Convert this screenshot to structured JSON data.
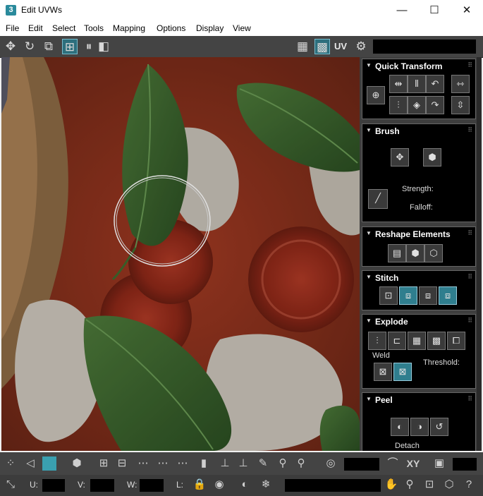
{
  "window": {
    "title": "Edit UVWs",
    "app_icon": "3",
    "minimize": "—",
    "maximize": "☐",
    "close": "✕"
  },
  "menu": [
    "File",
    "Edit",
    "Select",
    "Tools",
    "Mapping",
    "Options",
    "Display",
    "View"
  ],
  "toolbar": {
    "uv_label": "UV"
  },
  "panels": {
    "quick_transform": {
      "title": "Quick Transform"
    },
    "brush": {
      "title": "Brush",
      "strength_label": "Strength:",
      "falloff_label": "Falloff:"
    },
    "reshape": {
      "title": "Reshape Elements"
    },
    "stitch": {
      "title": "Stitch"
    },
    "explode": {
      "title": "Explode",
      "weld_label": "Weld",
      "threshold_label": "Threshold:"
    },
    "peel": {
      "title": "Peel",
      "detach_label": "Detach"
    }
  },
  "bottom_toolbar": {
    "xy_label": "XY"
  },
  "status": {
    "u_label": "U:",
    "v_label": "V:",
    "w_label": "W:",
    "l_label": "L:"
  },
  "colors": {
    "accent": "#2f7e8e",
    "panel_bg": "#3e3e3e",
    "toolbar_bg": "#444444"
  }
}
